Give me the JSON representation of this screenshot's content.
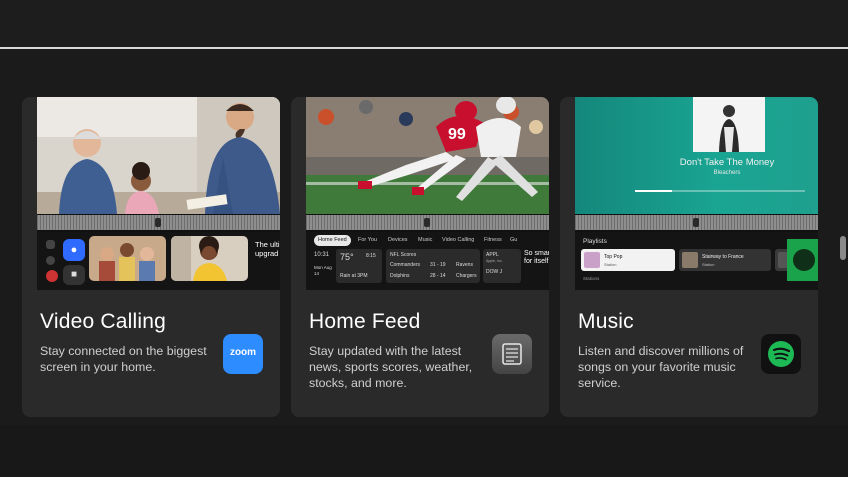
{
  "page": {
    "background": "#1b1b1b",
    "card_background": "#2a2a2a"
  },
  "cards": [
    {
      "title": "Video Calling",
      "description": "Stay connected on the biggest screen in your home.",
      "app_icon": {
        "name": "zoom-icon",
        "label": "zoom",
        "color": "#2d8cff"
      },
      "screen": {
        "side_text": "The ulti upgrad"
      }
    },
    {
      "title": "Home Feed",
      "description": "Stay updated with the latest news, sports scores, weather, stocks, and more.",
      "app_icon": {
        "name": "news-feed-icon",
        "color": "#555555"
      },
      "screen": {
        "tabs": [
          "Home Feed",
          "For You",
          "Devices",
          "Music",
          "Video Calling",
          "Fitness",
          "Gu"
        ],
        "time": "10:31",
        "date": "Mon Aug 14",
        "temp": "75°",
        "sun_time": "8:15",
        "weather_note": "Rain at 3PM",
        "scores_title": "NFL Scores",
        "scores": [
          {
            "home": "Commanders",
            "score": "31 - 19",
            "away": "Ravens"
          },
          {
            "home": "Dolphins",
            "score": "28 - 14",
            "away": "Chargers"
          }
        ],
        "stocks": [
          {
            "ticker": "APPL",
            "note": "Apple, Inc."
          },
          {
            "ticker": "DOW J",
            "note": ""
          }
        ],
        "side_text": "So smar for itself"
      }
    },
    {
      "title": "Music",
      "description": "Listen and discover millions of songs on your favorite music service.",
      "app_icon": {
        "name": "spotify-icon",
        "color": "#1db954"
      },
      "screen": {
        "now_playing_title": "Don't Take The Money",
        "now_playing_artist": "Bleachers",
        "progress": 0.22,
        "playlists_label": "Playlists",
        "playlists": [
          {
            "name": "Top Pop",
            "sub": "Station"
          },
          {
            "name": "Stairway to France",
            "sub": "Station"
          }
        ],
        "footer_label": "Stations"
      }
    }
  ]
}
